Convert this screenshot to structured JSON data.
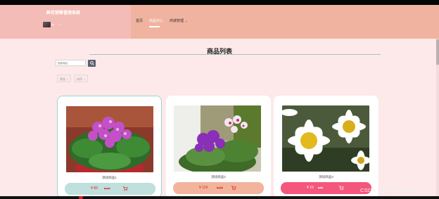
{
  "header": {
    "brand_title": "鲜花销售管理系统",
    "avatar_name": "hk",
    "nav": [
      {
        "label": "首页",
        "active": false
      },
      {
        "label": "商品中心",
        "active": true
      },
      {
        "label": "商城管理",
        "active": false
      }
    ]
  },
  "main": {
    "page_title": "商品列表",
    "search": {
      "placeholder": "搜索商品",
      "button_icon": "search-icon"
    },
    "filters": [
      {
        "label": "筛选"
      },
      {
        "label": "排序"
      }
    ],
    "products": [
      {
        "name": "测试商品1",
        "price": "¥ 89",
        "original_price": "¥ 118",
        "bar_color": "#bfe0dd"
      },
      {
        "name": "测试商品2",
        "price": "¥ 119",
        "original_price": "¥ 235",
        "bar_color": "#f2b49d"
      },
      {
        "name": "测试商品3",
        "price": "¥ 10",
        "original_price": "¥ 69",
        "bar_color": "#f5567b"
      }
    ]
  },
  "watermark": "CSDN @MZ_ZXD001",
  "colors": {
    "header_bg": "#f0b39f",
    "brand_panel_bg": "#f4bcb6",
    "page_bg": "#fde9ea",
    "price_text": "#dd2222"
  }
}
